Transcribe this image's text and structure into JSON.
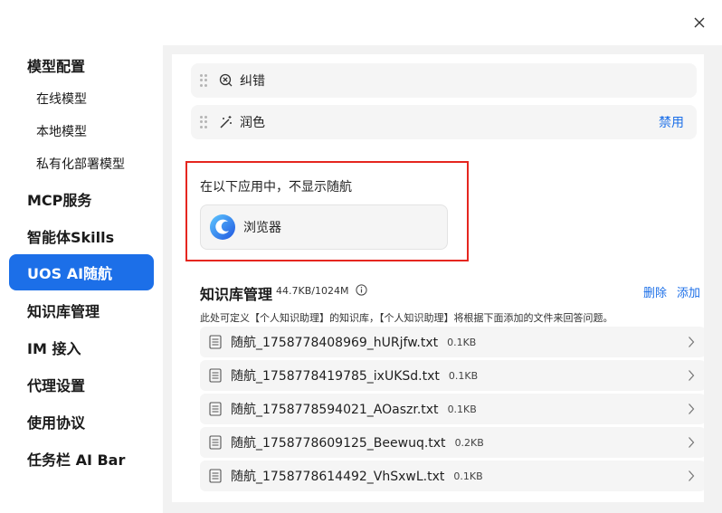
{
  "sidebar": {
    "items": [
      {
        "label": "模型配置"
      },
      {
        "label": "在线模型"
      },
      {
        "label": "本地模型"
      },
      {
        "label": "私有化部署模型"
      },
      {
        "label": "MCP服务"
      },
      {
        "label": "智能体Skills"
      },
      {
        "label": "UOS AI随航"
      },
      {
        "label": "知识库管理"
      },
      {
        "label": "IM 接入"
      },
      {
        "label": "代理设置"
      },
      {
        "label": "使用协议"
      },
      {
        "label": "任务栏 AI Bar"
      }
    ]
  },
  "tools": [
    {
      "label": "纠错",
      "icon": "x-circle-icon",
      "action": ""
    },
    {
      "label": "润色",
      "icon": "magic-wand-icon",
      "action": "禁用"
    }
  ],
  "hide_section": {
    "title": "在以下应用中，不显示随航",
    "apps": [
      {
        "label": "浏览器",
        "icon": "browser-icon"
      }
    ]
  },
  "knowledge": {
    "title": "知识库管理",
    "size": "44.7KB/1024M",
    "delete_label": "删除",
    "add_label": "添加",
    "description": "此处可定义【个人知识助理】的知识库，【个人知识助理】将根据下面添加的文件来回答问题。",
    "files": [
      {
        "name": "随航_1758778408969_hURjfw.txt",
        "size": "0.1KB"
      },
      {
        "name": "随航_1758778419785_ixUKSd.txt",
        "size": "0.1KB"
      },
      {
        "name": "随航_1758778594021_AOaszr.txt",
        "size": "0.1KB"
      },
      {
        "name": "随航_1758778609125_Beewuq.txt",
        "size": "0.2KB"
      },
      {
        "name": "随航_1758778614492_VhSxwL.txt",
        "size": "0.1KB"
      }
    ]
  },
  "colors": {
    "accent": "#1c6fe8",
    "highlight_border": "#e5261f"
  }
}
